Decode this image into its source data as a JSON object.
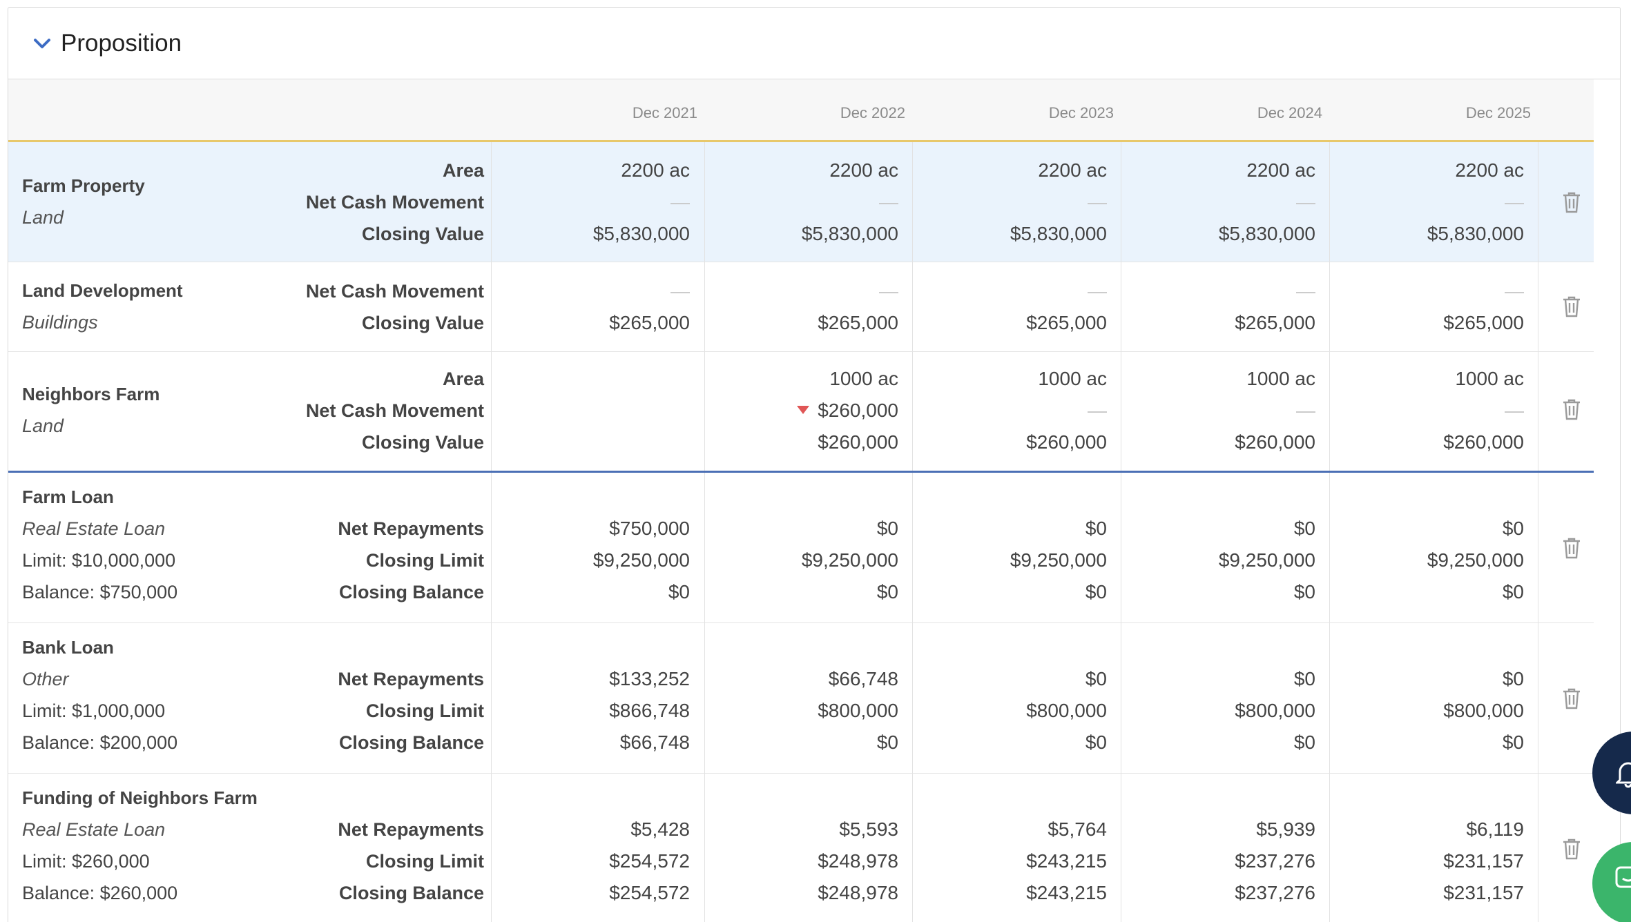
{
  "section": {
    "title": "Proposition"
  },
  "periods": [
    "Dec 2021",
    "Dec 2022",
    "Dec 2023",
    "Dec 2024",
    "Dec 2025"
  ],
  "colors": {
    "header_accent": "#e8c86b",
    "divider": "#4b6fb5",
    "highlight": "#eaf3fc",
    "negative": "#e05656"
  },
  "assets": [
    {
      "name": "Farm Property",
      "category": "Land",
      "metrics": [
        "Area",
        "Net Cash Movement",
        "Closing Value"
      ],
      "values": [
        [
          "2200 ac",
          "2200 ac",
          "2200 ac",
          "2200 ac",
          "2200 ac"
        ],
        [
          "—",
          "—",
          "—",
          "—",
          "—"
        ],
        [
          "$5,830,000",
          "$5,830,000",
          "$5,830,000",
          "$5,830,000",
          "$5,830,000"
        ]
      ]
    },
    {
      "name": "Land Development",
      "category": "Buildings",
      "metrics": [
        "Net Cash Movement",
        "Closing Value"
      ],
      "values": [
        [
          "—",
          "—",
          "—",
          "—",
          "—"
        ],
        [
          "$265,000",
          "$265,000",
          "$265,000",
          "$265,000",
          "$265,000"
        ]
      ]
    },
    {
      "name": "Neighbors Farm",
      "category": "Land",
      "metrics": [
        "Area",
        "Net Cash Movement",
        "Closing Value"
      ],
      "values": [
        [
          "",
          "1000 ac",
          "1000 ac",
          "1000 ac",
          "1000 ac"
        ],
        [
          "",
          "$260,000",
          "—",
          "—",
          "—"
        ],
        [
          "",
          "$260,000",
          "$260,000",
          "$260,000",
          "$260,000"
        ]
      ]
    }
  ],
  "loans": [
    {
      "name": "Farm Loan",
      "category": "Real Estate Loan",
      "limit": "Limit: $10,000,000",
      "balance": "Balance: $750,000",
      "metrics": [
        "Net Repayments",
        "Closing Limit",
        "Closing Balance"
      ],
      "values": [
        [
          "$750,000",
          "$0",
          "$0",
          "$0",
          "$0"
        ],
        [
          "$9,250,000",
          "$9,250,000",
          "$9,250,000",
          "$9,250,000",
          "$9,250,000"
        ],
        [
          "$0",
          "$0",
          "$0",
          "$0",
          "$0"
        ]
      ]
    },
    {
      "name": "Bank Loan",
      "category": "Other",
      "limit": "Limit: $1,000,000",
      "balance": "Balance: $200,000",
      "metrics": [
        "Net Repayments",
        "Closing Limit",
        "Closing Balance"
      ],
      "values": [
        [
          "$133,252",
          "$66,748",
          "$0",
          "$0",
          "$0"
        ],
        [
          "$866,748",
          "$800,000",
          "$800,000",
          "$800,000",
          "$800,000"
        ],
        [
          "$66,748",
          "$0",
          "$0",
          "$0",
          "$0"
        ]
      ]
    },
    {
      "name": "Funding of Neighbors Farm",
      "category": "Real Estate Loan",
      "limit": "Limit: $260,000",
      "balance": "Balance: $260,000",
      "metrics": [
        "Net Repayments",
        "Closing Limit",
        "Closing Balance"
      ],
      "values": [
        [
          "$5,428",
          "$5,593",
          "$5,764",
          "$5,939",
          "$6,119"
        ],
        [
          "$254,572",
          "$248,978",
          "$243,215",
          "$237,276",
          "$231,157"
        ],
        [
          "$254,572",
          "$248,978",
          "$243,215",
          "$237,276",
          "$231,157"
        ]
      ]
    }
  ]
}
